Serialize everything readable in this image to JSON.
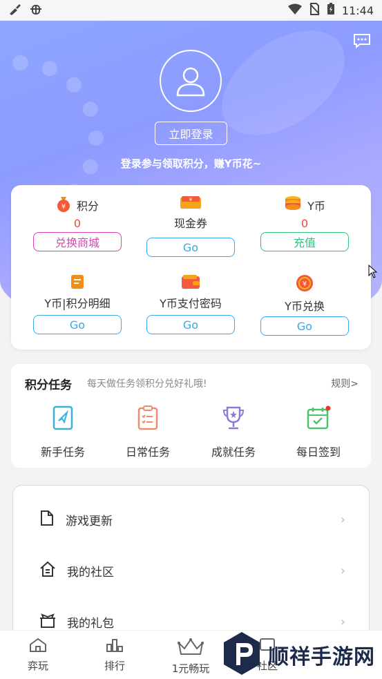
{
  "status_bar": {
    "time": "11:44"
  },
  "header": {
    "login_button": "立即登录",
    "login_tip": "登录参与领取积分，赚Y币花~"
  },
  "wallet": {
    "points": {
      "label": "积分",
      "value": "0",
      "button": "兑换商城"
    },
    "coupon": {
      "label": "现金券",
      "button": "Go"
    },
    "ycoin": {
      "label": "Y币",
      "value": "0",
      "button": "充值"
    },
    "detail": {
      "label": "Y币|积分明细",
      "button": "Go"
    },
    "paypwd": {
      "label": "Y币支付密码",
      "button": "Go"
    },
    "exchange": {
      "label": "Y币兑换",
      "button": "Go"
    }
  },
  "tasks": {
    "title": "积分任务",
    "subtitle": "每天做任务领积分兑好礼哦!",
    "rule_link": "规则>",
    "items": [
      {
        "label": "新手任务",
        "icon": "newbie-task-icon"
      },
      {
        "label": "日常任务",
        "icon": "daily-task-icon"
      },
      {
        "label": "成就任务",
        "icon": "achievement-trophy-icon"
      },
      {
        "label": "每日签到",
        "icon": "calendar-checkin-icon"
      }
    ]
  },
  "menu": {
    "items": [
      {
        "label": "游戏更新",
        "icon": "document-icon"
      },
      {
        "label": "我的社区",
        "icon": "home-icon"
      },
      {
        "label": "我的礼包",
        "icon": "gift-icon"
      }
    ]
  },
  "tabbar": {
    "items": [
      {
        "label": "弈玩",
        "icon": "home-tab-icon"
      },
      {
        "label": "排行",
        "icon": "ranking-icon"
      },
      {
        "label": "1元畅玩",
        "icon": "crown-icon"
      },
      {
        "label": "社区",
        "icon": "community-icon"
      }
    ]
  },
  "watermark": {
    "text": "顺祥手游网"
  },
  "colors": {
    "accent_pink": "#e040b4",
    "accent_blue": "#3aa7e8",
    "accent_green": "#2fc27a",
    "value_red": "#e84c3d",
    "header_gradient": "#8fa6ff"
  }
}
